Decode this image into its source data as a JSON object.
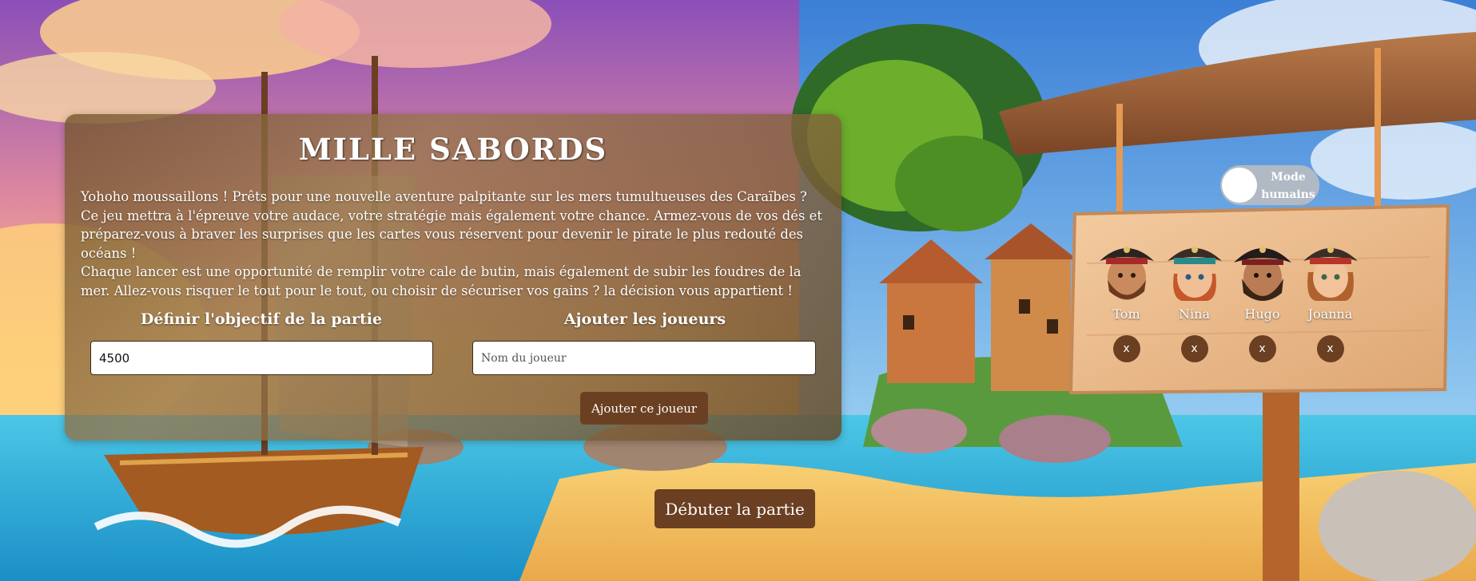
{
  "title": "MILLE SABORDS",
  "intro": {
    "line1": "Yohoho moussaillons ! Prêts pour une nouvelle aventure palpitante sur les mers tumultueuses des Caraïbes ?",
    "line2": "Ce jeu mettra à l'épreuve votre audace, votre stratégie mais également votre chance. Armez-vous de vos dés et préparez-vous à braver les surprises que les cartes vous réservent pour devenir le pirate le plus redouté des océans !",
    "line3": "Chaque lancer est une opportunité de remplir votre cale de butin, mais également de subir les foudres de la mer. Allez-vous risquer le tout pour le tout, ou choisir de sécuriser vos gains ? la décision vous appartient !"
  },
  "goal": {
    "label": "Définir l'objectif  de la partie",
    "value": "4500"
  },
  "players_form": {
    "label": "Ajouter les joueurs",
    "placeholder": "Nom du joueur",
    "add_button": "Ajouter ce joueur"
  },
  "mode_toggle": {
    "label_line1": "Mode",
    "label_line2": "humains",
    "state": "off"
  },
  "players": [
    {
      "name": "Tom",
      "remove_label": "x",
      "avatar_icon": "pirate-man-avatar"
    },
    {
      "name": "Nina",
      "remove_label": "x",
      "avatar_icon": "pirate-girl-avatar"
    },
    {
      "name": "Hugo",
      "remove_label": "x",
      "avatar_icon": "pirate-bearded-avatar"
    },
    {
      "name": "Joanna",
      "remove_label": "x",
      "avatar_icon": "pirate-woman-avatar"
    }
  ],
  "start_button": "Débuter la partie",
  "colors": {
    "button_brown": "#6b3f22",
    "panel_brown": "#8a6538",
    "sign_wood": "#e8b98a"
  }
}
